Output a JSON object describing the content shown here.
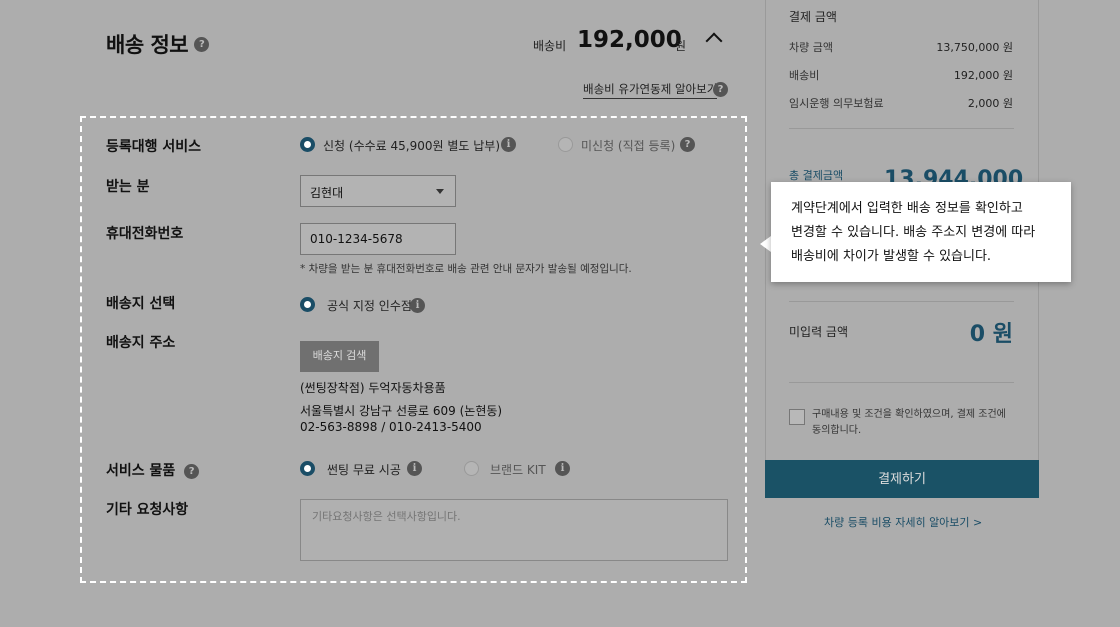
{
  "header": {
    "title": "배송 정보",
    "fee_label": "배송비",
    "fee_value": "192,000",
    "fee_unit": "원",
    "policy_link": "배송비 유가연동제 알아보기"
  },
  "form": {
    "registration": {
      "label": "등록대행 서비스",
      "option_apply": "신청 (수수료 45,900원 별도 납부)",
      "option_not_apply": "미신청 (직접 등록)"
    },
    "recipient": {
      "label": "받는 분",
      "value": "김현대"
    },
    "phone": {
      "label": "휴대전화번호",
      "value": "010-1234-5678",
      "note": "* 차량을 받는 분 휴대전화번호로 배송 관련 안내 문자가 발송될 예정입니다."
    },
    "delivery_choice": {
      "label": "배송지 선택",
      "option": "공식 지정 인수점"
    },
    "address": {
      "label": "배송지 주소",
      "search_button": "배송지 검색",
      "line1": "(썬팅장착점) 두억자동차용품",
      "line2": "서울특별시 강남구 선릉로 609 (논현동)",
      "line3": "02-563-8898 / 010-2413-5400"
    },
    "service_items": {
      "label": "서비스 물품",
      "option_tint": "썬팅 무료 시공",
      "option_kit": "브랜드 KIT"
    },
    "requests": {
      "label": "기타 요청사항",
      "placeholder": "기타요청사항은 선택사항입니다."
    }
  },
  "summary": {
    "title": "결제 금액",
    "rows": [
      {
        "label": "차량 금액",
        "value": "13,750,000 원"
      },
      {
        "label": "배송비",
        "value": "192,000 원"
      },
      {
        "label": "임시운행 의무보험료",
        "value": "2,000 원"
      }
    ],
    "total_label": "총 결제금액",
    "total_value": "13,944,000",
    "unpaid_label": "미입력 금액",
    "unpaid_value": "0 원",
    "agree_text": "구매내용 및 조건을 확인하였으며, 결제 조건에 동의합니다.",
    "pay_button": "결제하기",
    "registration_link": "차량 등록 비용 자세히 알아보기 >"
  },
  "tooltip": {
    "line1": "계약단계에서 입력한 배송 정보를 확인하고",
    "line2": "변경할 수 있습니다. 배송 주소지 변경에 따라",
    "line3": "배송비에 차이가 발생할 수 있습니다."
  },
  "colors": {
    "accent": "#1a5266",
    "overlay_bg": "#adadad"
  }
}
